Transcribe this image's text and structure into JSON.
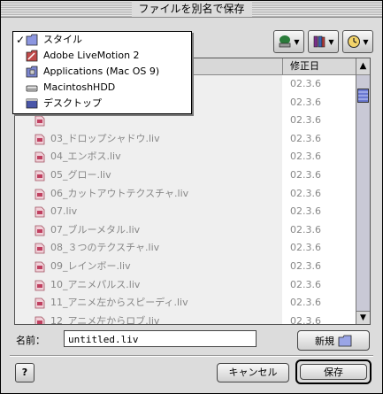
{
  "window": {
    "title": "ファイルを別名で保存"
  },
  "popup_menu": {
    "items": [
      {
        "label": "スタイル",
        "icon": "folder-icon",
        "checked": true
      },
      {
        "label": "Adobe LiveMotion 2",
        "icon": "livemotion-folder-icon",
        "checked": false
      },
      {
        "label": "Applications (Mac OS 9)",
        "icon": "applications-folder-icon",
        "checked": false
      },
      {
        "label": "MacintoshHDD",
        "icon": "hard-disk-icon",
        "checked": false
      },
      {
        "label": "デスクトップ",
        "icon": "desktop-icon",
        "checked": false
      }
    ]
  },
  "toolbar": {
    "buttons": [
      {
        "icon": "network-icon"
      },
      {
        "icon": "favorites-icon"
      },
      {
        "icon": "recent-clock-icon"
      }
    ]
  },
  "file_list": {
    "column_date": "修正日",
    "sort_indicator": "▲",
    "rows": [
      {
        "name": "",
        "date": "02.3.6"
      },
      {
        "name": "",
        "date": "02.3.6"
      },
      {
        "name": "",
        "date": "02.3.6"
      },
      {
        "name": "03_ドロップシャドウ.liv",
        "date": "02.3.6"
      },
      {
        "name": "04_エンボス.liv",
        "date": "02.3.6"
      },
      {
        "name": "05_グロー.liv",
        "date": "02.3.6"
      },
      {
        "name": "06_カットアウトテクスチャ.liv",
        "date": "02.3.6"
      },
      {
        "name": "07.liv",
        "date": "02.3.6"
      },
      {
        "name": "07_ブルーメタル.liv",
        "date": "02.3.6"
      },
      {
        "name": "08_３つのテクスチャ.liv",
        "date": "02.3.6"
      },
      {
        "name": "09_レインボー.liv",
        "date": "02.3.6"
      },
      {
        "name": "10_アニメパルス.liv",
        "date": "02.3.6"
      },
      {
        "name": "11_アニメ左からスピーディ.liv",
        "date": "02.3.6"
      },
      {
        "name": "12_アニメ左からロブ.liv",
        "date": "02.3.6"
      }
    ]
  },
  "name_field": {
    "label": "名前：",
    "value": "untitled.liv"
  },
  "buttons": {
    "new": "新規",
    "help": "?",
    "cancel": "キャンセル",
    "save": "保存"
  }
}
